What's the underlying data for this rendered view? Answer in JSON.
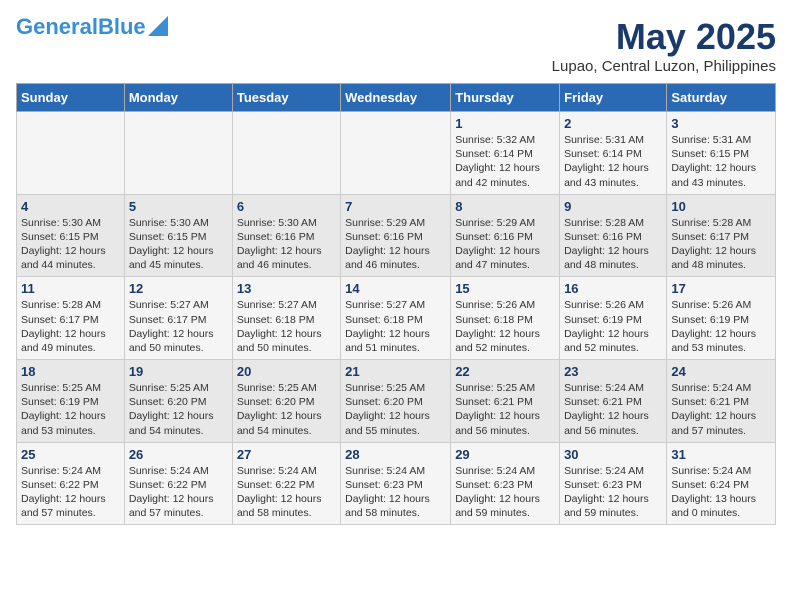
{
  "header": {
    "logo_general": "General",
    "logo_blue": "Blue",
    "title": "May 2025",
    "subtitle": "Lupao, Central Luzon, Philippines"
  },
  "calendar": {
    "days_of_week": [
      "Sunday",
      "Monday",
      "Tuesday",
      "Wednesday",
      "Thursday",
      "Friday",
      "Saturday"
    ],
    "weeks": [
      [
        {
          "day": "",
          "detail": ""
        },
        {
          "day": "",
          "detail": ""
        },
        {
          "day": "",
          "detail": ""
        },
        {
          "day": "",
          "detail": ""
        },
        {
          "day": "1",
          "detail": "Sunrise: 5:32 AM\nSunset: 6:14 PM\nDaylight: 12 hours\nand 42 minutes."
        },
        {
          "day": "2",
          "detail": "Sunrise: 5:31 AM\nSunset: 6:14 PM\nDaylight: 12 hours\nand 43 minutes."
        },
        {
          "day": "3",
          "detail": "Sunrise: 5:31 AM\nSunset: 6:15 PM\nDaylight: 12 hours\nand 43 minutes."
        }
      ],
      [
        {
          "day": "4",
          "detail": "Sunrise: 5:30 AM\nSunset: 6:15 PM\nDaylight: 12 hours\nand 44 minutes."
        },
        {
          "day": "5",
          "detail": "Sunrise: 5:30 AM\nSunset: 6:15 PM\nDaylight: 12 hours\nand 45 minutes."
        },
        {
          "day": "6",
          "detail": "Sunrise: 5:30 AM\nSunset: 6:16 PM\nDaylight: 12 hours\nand 46 minutes."
        },
        {
          "day": "7",
          "detail": "Sunrise: 5:29 AM\nSunset: 6:16 PM\nDaylight: 12 hours\nand 46 minutes."
        },
        {
          "day": "8",
          "detail": "Sunrise: 5:29 AM\nSunset: 6:16 PM\nDaylight: 12 hours\nand 47 minutes."
        },
        {
          "day": "9",
          "detail": "Sunrise: 5:28 AM\nSunset: 6:16 PM\nDaylight: 12 hours\nand 48 minutes."
        },
        {
          "day": "10",
          "detail": "Sunrise: 5:28 AM\nSunset: 6:17 PM\nDaylight: 12 hours\nand 48 minutes."
        }
      ],
      [
        {
          "day": "11",
          "detail": "Sunrise: 5:28 AM\nSunset: 6:17 PM\nDaylight: 12 hours\nand 49 minutes."
        },
        {
          "day": "12",
          "detail": "Sunrise: 5:27 AM\nSunset: 6:17 PM\nDaylight: 12 hours\nand 50 minutes."
        },
        {
          "day": "13",
          "detail": "Sunrise: 5:27 AM\nSunset: 6:18 PM\nDaylight: 12 hours\nand 50 minutes."
        },
        {
          "day": "14",
          "detail": "Sunrise: 5:27 AM\nSunset: 6:18 PM\nDaylight: 12 hours\nand 51 minutes."
        },
        {
          "day": "15",
          "detail": "Sunrise: 5:26 AM\nSunset: 6:18 PM\nDaylight: 12 hours\nand 52 minutes."
        },
        {
          "day": "16",
          "detail": "Sunrise: 5:26 AM\nSunset: 6:19 PM\nDaylight: 12 hours\nand 52 minutes."
        },
        {
          "day": "17",
          "detail": "Sunrise: 5:26 AM\nSunset: 6:19 PM\nDaylight: 12 hours\nand 53 minutes."
        }
      ],
      [
        {
          "day": "18",
          "detail": "Sunrise: 5:25 AM\nSunset: 6:19 PM\nDaylight: 12 hours\nand 53 minutes."
        },
        {
          "day": "19",
          "detail": "Sunrise: 5:25 AM\nSunset: 6:20 PM\nDaylight: 12 hours\nand 54 minutes."
        },
        {
          "day": "20",
          "detail": "Sunrise: 5:25 AM\nSunset: 6:20 PM\nDaylight: 12 hours\nand 54 minutes."
        },
        {
          "day": "21",
          "detail": "Sunrise: 5:25 AM\nSunset: 6:20 PM\nDaylight: 12 hours\nand 55 minutes."
        },
        {
          "day": "22",
          "detail": "Sunrise: 5:25 AM\nSunset: 6:21 PM\nDaylight: 12 hours\nand 56 minutes."
        },
        {
          "day": "23",
          "detail": "Sunrise: 5:24 AM\nSunset: 6:21 PM\nDaylight: 12 hours\nand 56 minutes."
        },
        {
          "day": "24",
          "detail": "Sunrise: 5:24 AM\nSunset: 6:21 PM\nDaylight: 12 hours\nand 57 minutes."
        }
      ],
      [
        {
          "day": "25",
          "detail": "Sunrise: 5:24 AM\nSunset: 6:22 PM\nDaylight: 12 hours\nand 57 minutes."
        },
        {
          "day": "26",
          "detail": "Sunrise: 5:24 AM\nSunset: 6:22 PM\nDaylight: 12 hours\nand 57 minutes."
        },
        {
          "day": "27",
          "detail": "Sunrise: 5:24 AM\nSunset: 6:22 PM\nDaylight: 12 hours\nand 58 minutes."
        },
        {
          "day": "28",
          "detail": "Sunrise: 5:24 AM\nSunset: 6:23 PM\nDaylight: 12 hours\nand 58 minutes."
        },
        {
          "day": "29",
          "detail": "Sunrise: 5:24 AM\nSunset: 6:23 PM\nDaylight: 12 hours\nand 59 minutes."
        },
        {
          "day": "30",
          "detail": "Sunrise: 5:24 AM\nSunset: 6:23 PM\nDaylight: 12 hours\nand 59 minutes."
        },
        {
          "day": "31",
          "detail": "Sunrise: 5:24 AM\nSunset: 6:24 PM\nDaylight: 13 hours\nand 0 minutes."
        }
      ]
    ]
  }
}
